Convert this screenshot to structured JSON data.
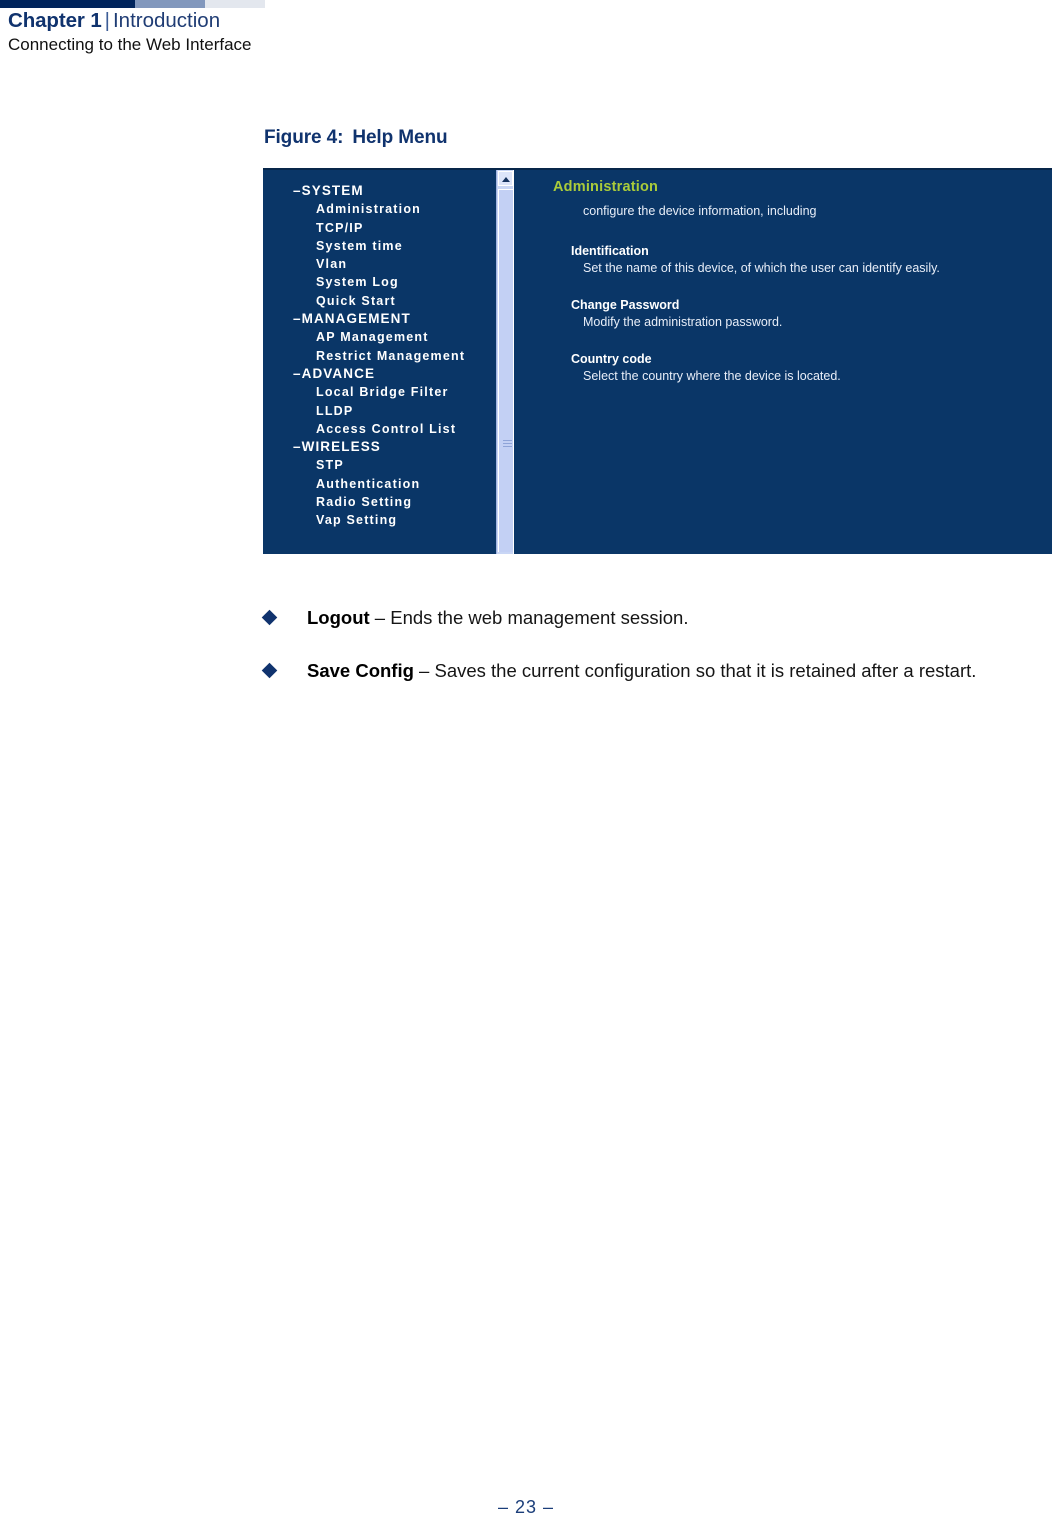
{
  "running_head": {
    "chapter": "Chapter 1",
    "separator": "|",
    "section": "Introduction",
    "subtitle": "Connecting to the Web Interface"
  },
  "figure": {
    "number": "Figure 4:",
    "title": "Help Menu"
  },
  "screenshot": {
    "nav": {
      "items": [
        {
          "label": "–SYSTEM",
          "type": "group"
        },
        {
          "label": "Administration",
          "type": "item"
        },
        {
          "label": "TCP/IP",
          "type": "item"
        },
        {
          "label": "System time",
          "type": "item"
        },
        {
          "label": "Vlan",
          "type": "item"
        },
        {
          "label": "System Log",
          "type": "item"
        },
        {
          "label": "Quick Start",
          "type": "item"
        },
        {
          "label": "–MANAGEMENT",
          "type": "group"
        },
        {
          "label": "AP Management",
          "type": "item"
        },
        {
          "label": "Restrict Management",
          "type": "item"
        },
        {
          "label": "–ADVANCE",
          "type": "group"
        },
        {
          "label": "Local Bridge Filter",
          "type": "item"
        },
        {
          "label": "LLDP",
          "type": "item"
        },
        {
          "label": "Access Control List",
          "type": "item"
        },
        {
          "label": "–WIRELESS",
          "type": "group"
        },
        {
          "label": "STP",
          "type": "item"
        },
        {
          "label": "Authentication",
          "type": "item"
        },
        {
          "label": "Radio Setting",
          "type": "item"
        },
        {
          "label": "Vap Setting",
          "type": "item"
        }
      ]
    },
    "content": {
      "title": "Administration",
      "lead": "configure the device information, including",
      "sections": [
        {
          "title": "Identification",
          "desc": "Set the name of this device, of which the user can identify easily."
        },
        {
          "title": "Change Password",
          "desc": "Modify the administration password."
        },
        {
          "title": "Country code",
          "desc": "Select the country where the device is located."
        }
      ]
    },
    "colors": {
      "background": "#0a3667",
      "heading": "#aacc3a",
      "text": "#e8eef8",
      "scrollbar_track": "#c9d6f5",
      "scrollbar_thumb": "#c3d0f4"
    }
  },
  "bullets": [
    {
      "term": "Logout",
      "desc": " – Ends the web management session."
    },
    {
      "term": "Save Config",
      "desc": " – Saves the current configuration so that it is retained after a restart."
    }
  ],
  "footer": {
    "page": "–  23  –"
  },
  "theme": {
    "rule_dark": "#00245c",
    "rule_mid": "#8298bd",
    "rule_light": "#e3e7ee",
    "heading_blue": "#10336e"
  }
}
